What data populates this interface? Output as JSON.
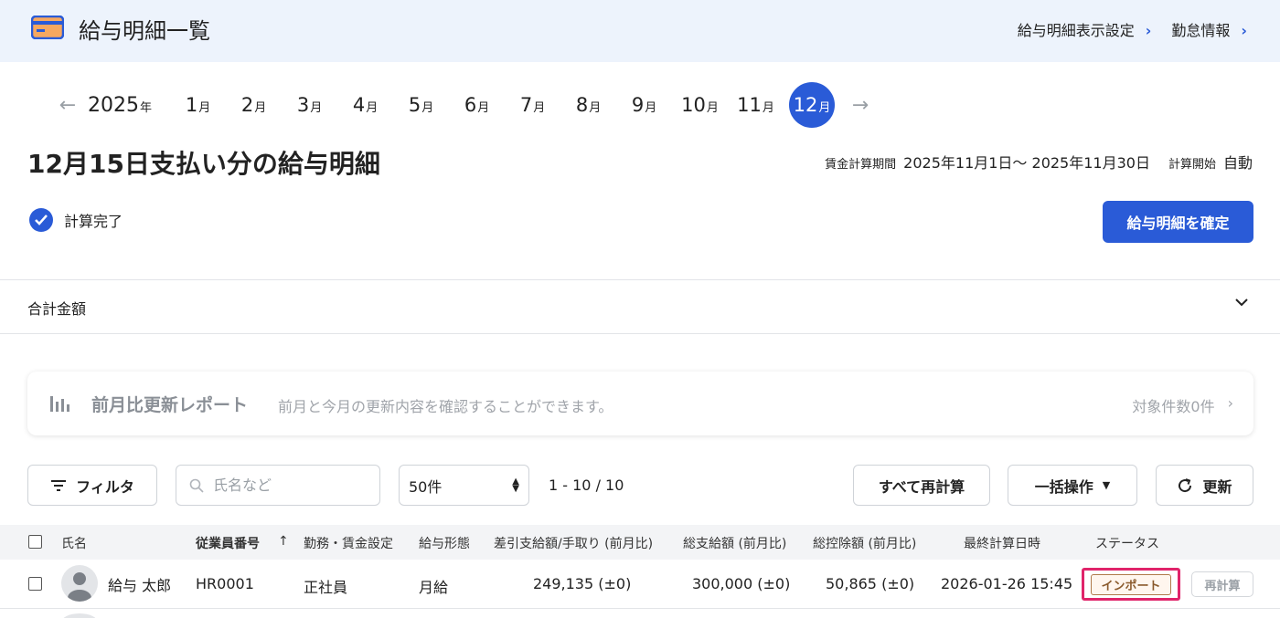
{
  "header": {
    "title": "給与明細一覧",
    "links": [
      "給与明細表示設定",
      "勤怠情報"
    ]
  },
  "months": {
    "year": "2025",
    "year_suffix": "年",
    "month_suffix": "月",
    "items": [
      "1",
      "2",
      "3",
      "4",
      "5",
      "6",
      "7",
      "8",
      "9",
      "10",
      "11",
      "12"
    ],
    "active": "12"
  },
  "payslip": {
    "title": "12月15日支払い分の給与明細",
    "period_label": "賃金計算期間",
    "period_value": "2025年11月1日～ 2025年11月30日",
    "calc_start_label": "計算開始",
    "calc_start_value": "自動",
    "status": "計算完了",
    "confirm_button": "給与明細を確定"
  },
  "totals": {
    "label": "合計金額"
  },
  "report": {
    "title": "前月比更新レポート",
    "description": "前月と今月の更新内容を確認することができます。",
    "count": "対象件数0件"
  },
  "toolbar": {
    "filter": "フィルタ",
    "search_placeholder": "氏名など",
    "page_size": "50件",
    "range": "1 - 10 / 10",
    "recalc_all": "すべて再計算",
    "bulk": "一括操作",
    "refresh": "更新"
  },
  "table": {
    "columns": [
      "氏名",
      "従業員番号",
      "勤務・賃金設定",
      "給与形態",
      "差引支給額/手取り (前月比)",
      "総支給額 (前月比)",
      "総控除額 (前月比)",
      "最終計算日時",
      "ステータス"
    ],
    "rows": [
      {
        "name": "給与 太郎",
        "employee_no": "HR0001",
        "work_setting": "正社員",
        "pay_type": "月給",
        "net": "249,135 (±0)",
        "gross": "300,000 (±0)",
        "deduction": "50,865 (±0)",
        "last_calc": "2026-01-26 15:45",
        "status": "インポート",
        "action": "再計算"
      }
    ]
  },
  "colors": {
    "primary": "#2a5bd7",
    "header_bg": "#edf3fc",
    "highlight": "#e0246a"
  }
}
